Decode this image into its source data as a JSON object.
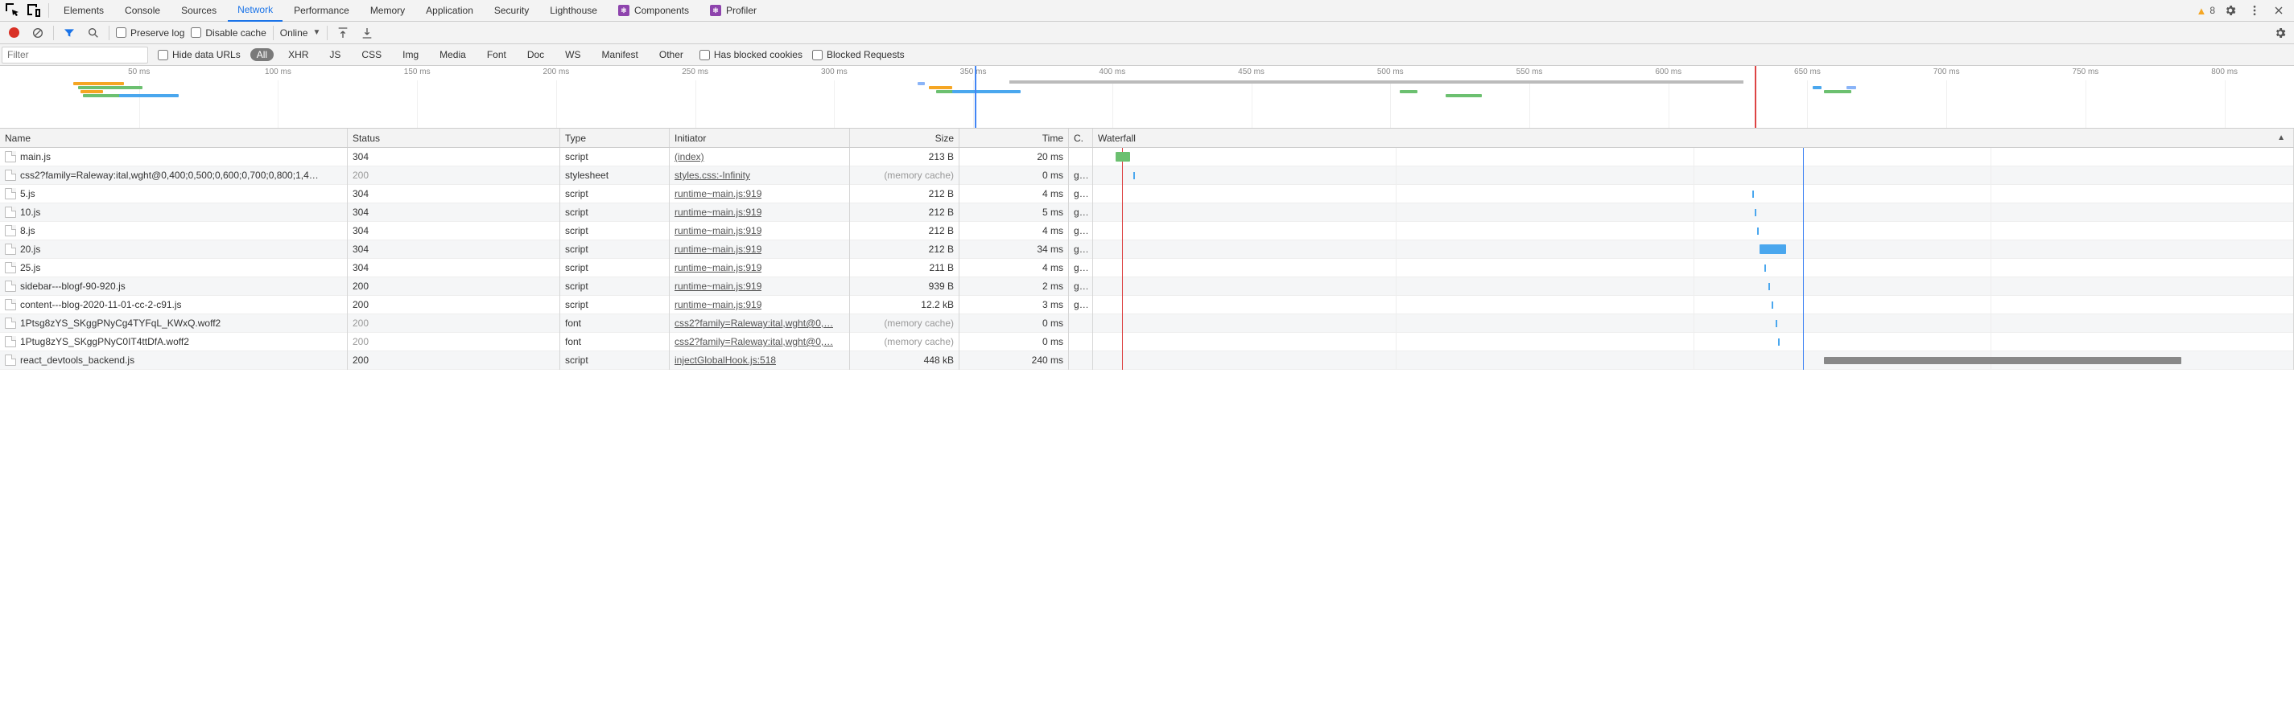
{
  "tabs": {
    "items": [
      "Elements",
      "Console",
      "Sources",
      "Network",
      "Performance",
      "Memory",
      "Application",
      "Security",
      "Lighthouse"
    ],
    "active_index": 3,
    "extensions": [
      {
        "label": "Components"
      },
      {
        "label": "Profiler"
      }
    ],
    "warnings_count": "8"
  },
  "toolbar": {
    "preserve_log": "Preserve log",
    "disable_cache": "Disable cache",
    "throttling": "Online"
  },
  "filterbar": {
    "placeholder": "Filter",
    "hide_data_urls": "Hide data URLs",
    "types": [
      "All",
      "XHR",
      "JS",
      "CSS",
      "Img",
      "Media",
      "Font",
      "Doc",
      "WS",
      "Manifest",
      "Other"
    ],
    "types_active_index": 0,
    "has_blocked_cookies": "Has blocked cookies",
    "blocked_requests": "Blocked Requests"
  },
  "overview": {
    "ticks": [
      "50 ms",
      "100 ms",
      "150 ms",
      "200 ms",
      "250 ms",
      "300 ms",
      "350 ms",
      "400 ms",
      "450 ms",
      "500 ms",
      "550 ms",
      "600 ms",
      "650 ms",
      "700 ms",
      "750 ms",
      "800 ms"
    ]
  },
  "columns": {
    "name": "Name",
    "status": "Status",
    "type": "Type",
    "initiator": "Initiator",
    "size": "Size",
    "time": "Time",
    "cookies": "C.",
    "waterfall": "Waterfall"
  },
  "requests": [
    {
      "name": "main.js",
      "status": "304",
      "status_muted": false,
      "type": "script",
      "initiator": "(index)",
      "size": "213 B",
      "size_muted": false,
      "time": "20 ms",
      "c": "",
      "wf": {
        "start": 1.5,
        "width": 1.2,
        "color": "#6cc070",
        "tick": false
      }
    },
    {
      "name": "css2?family=Raleway:ital,wght@0,400;0,500;0,600;0,700;0,800;1,4…",
      "status": "200",
      "status_muted": true,
      "type": "stylesheet",
      "initiator": "styles.css:-Infinity",
      "size": "(memory cache)",
      "size_muted": true,
      "time": "0 ms",
      "c": "g…",
      "wf": {
        "start": 3.0,
        "width": 0,
        "color": "#4aa7ee",
        "tick": true
      }
    },
    {
      "name": "5.js",
      "status": "304",
      "status_muted": false,
      "type": "script",
      "initiator": "runtime~main.js:919",
      "size": "212 B",
      "size_muted": false,
      "time": "4 ms",
      "c": "g…",
      "wf": {
        "start": 55.0,
        "width": 0,
        "color": "#4aa7ee",
        "tick": true
      }
    },
    {
      "name": "10.js",
      "status": "304",
      "status_muted": false,
      "type": "script",
      "initiator": "runtime~main.js:919",
      "size": "212 B",
      "size_muted": false,
      "time": "5 ms",
      "c": "g…",
      "wf": {
        "start": 55.2,
        "width": 0,
        "color": "#4aa7ee",
        "tick": true
      }
    },
    {
      "name": "8.js",
      "status": "304",
      "status_muted": false,
      "type": "script",
      "initiator": "runtime~main.js:919",
      "size": "212 B",
      "size_muted": false,
      "time": "4 ms",
      "c": "g…",
      "wf": {
        "start": 55.4,
        "width": 0,
        "color": "#4aa7ee",
        "tick": true
      }
    },
    {
      "name": "20.js",
      "status": "304",
      "status_muted": false,
      "type": "script",
      "initiator": "runtime~main.js:919",
      "size": "212 B",
      "size_muted": false,
      "time": "34 ms",
      "c": "g…",
      "wf": {
        "start": 55.6,
        "width": 2.2,
        "color": "#4aa7ee",
        "tick": false
      }
    },
    {
      "name": "25.js",
      "status": "304",
      "status_muted": false,
      "type": "script",
      "initiator": "runtime~main.js:919",
      "size": "211 B",
      "size_muted": false,
      "time": "4 ms",
      "c": "g…",
      "wf": {
        "start": 56.0,
        "width": 0,
        "color": "#4aa7ee",
        "tick": true
      }
    },
    {
      "name": "sidebar---blogf-90-920.js",
      "status": "200",
      "status_muted": false,
      "type": "script",
      "initiator": "runtime~main.js:919",
      "size": "939 B",
      "size_muted": false,
      "time": "2 ms",
      "c": "g…",
      "wf": {
        "start": 56.3,
        "width": 0,
        "color": "#4aa7ee",
        "tick": true
      }
    },
    {
      "name": "content---blog-2020-11-01-cc-2-c91.js",
      "status": "200",
      "status_muted": false,
      "type": "script",
      "initiator": "runtime~main.js:919",
      "size": "12.2 kB",
      "size_muted": false,
      "time": "3 ms",
      "c": "g…",
      "wf": {
        "start": 56.6,
        "width": 0,
        "color": "#4aa7ee",
        "tick": true
      }
    },
    {
      "name": "1Ptsg8zYS_SKggPNyCg4TYFqL_KWxQ.woff2",
      "status": "200",
      "status_muted": true,
      "type": "font",
      "initiator": "css2?family=Raleway:ital,wght@0,…",
      "size": "(memory cache)",
      "size_muted": true,
      "time": "0 ms",
      "c": "",
      "wf": {
        "start": 56.9,
        "width": 0,
        "color": "#4aa7ee",
        "tick": true
      }
    },
    {
      "name": "1Ptug8zYS_SKggPNyC0IT4ttDfA.woff2",
      "status": "200",
      "status_muted": true,
      "type": "font",
      "initiator": "css2?family=Raleway:ital,wght@0,…",
      "size": "(memory cache)",
      "size_muted": true,
      "time": "0 ms",
      "c": "",
      "wf": {
        "start": 57.1,
        "width": 0,
        "color": "#4aa7ee",
        "tick": true
      }
    },
    {
      "name": "react_devtools_backend.js",
      "status": "200",
      "status_muted": false,
      "type": "script",
      "initiator": "injectGlobalHook.js:518",
      "size": "448 kB",
      "size_muted": false,
      "time": "240 ms",
      "c": "",
      "wf": {
        "start": 61.0,
        "width": 30.0,
        "color": "#9c9c9c",
        "tick": false
      }
    }
  ],
  "wf_redline_pct": 59.2,
  "wf_blueline_pct": 100.0
}
